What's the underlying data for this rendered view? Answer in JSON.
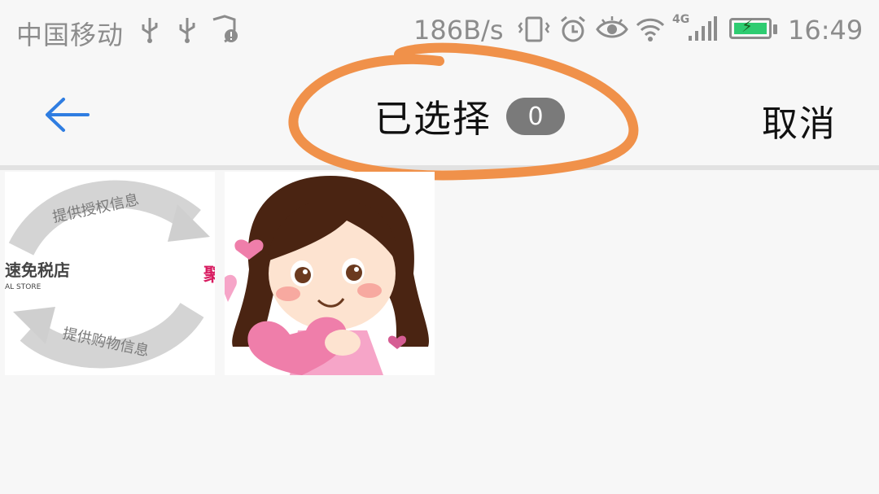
{
  "status_bar": {
    "carrier": "中国移动",
    "net_speed": "186B/s",
    "time": "16:49",
    "signal_label": "4G",
    "icons": [
      "usb-icon",
      "usb-icon",
      "shield-alert-icon",
      "vibrate-icon",
      "alarm-icon",
      "eye-icon",
      "wifi-icon",
      "signal-icon",
      "battery-icon"
    ],
    "battery_color": "#2ecc71"
  },
  "header": {
    "title": "已选择",
    "selected_count": "0",
    "cancel_label": "取消",
    "accent_color": "#2f7de1"
  },
  "annotation": {
    "color": "#f0914a"
  },
  "images": [
    {
      "name": "authorization-diagram",
      "text_top": "提供授权信息",
      "text_middle": "速免税店",
      "text_sub": "AL STORE",
      "text_bottom": "提供购物信息",
      "text_edge": "聚"
    },
    {
      "name": "cartoon-girl-heart"
    }
  ]
}
